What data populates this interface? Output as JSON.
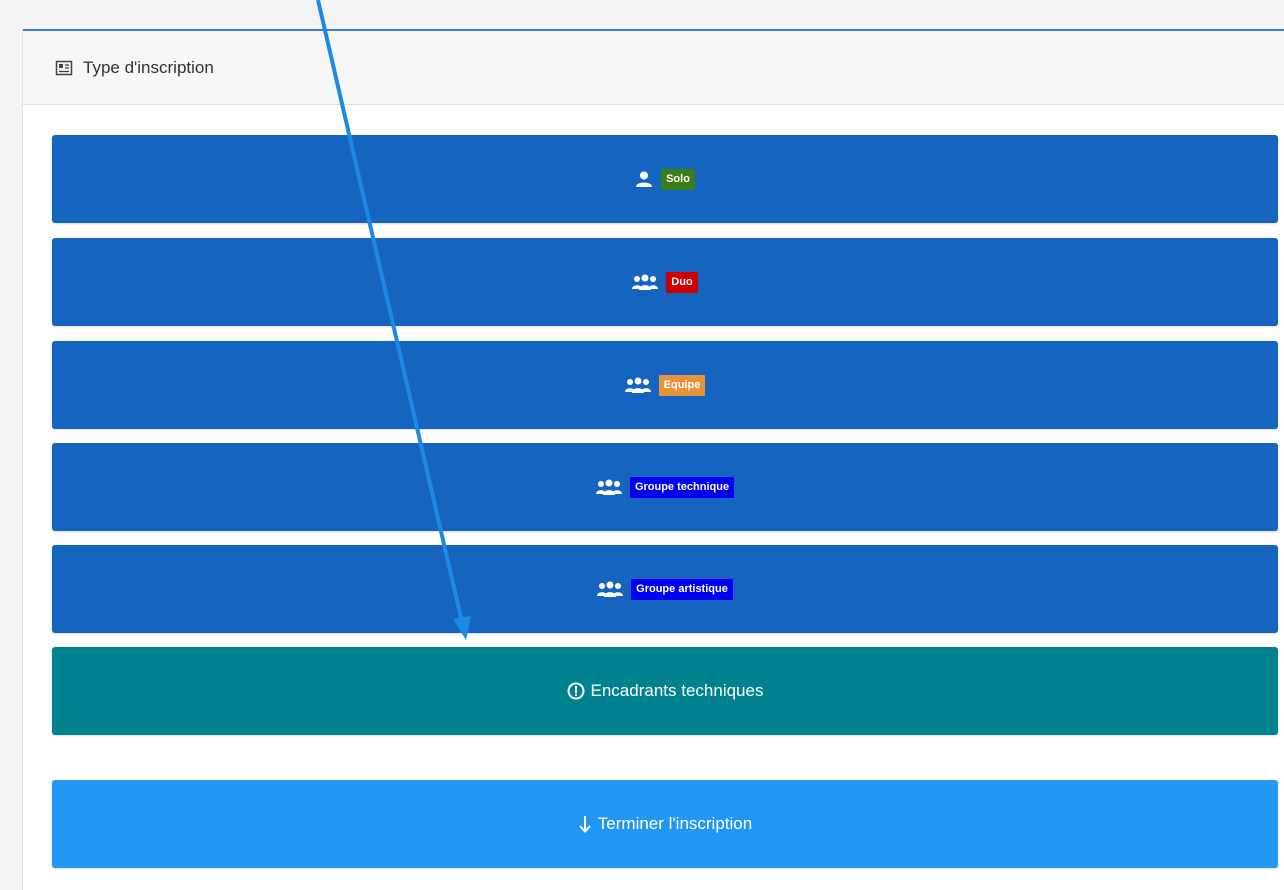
{
  "header": {
    "title": "Type d'inscription",
    "icon": "id-card-icon"
  },
  "choices": [
    {
      "label": "Solo",
      "icon": "person-icon",
      "badge_color": "#3a7d1a"
    },
    {
      "label": "Duo",
      "icon": "group-icon",
      "badge_color": "#cc0000"
    },
    {
      "label": "Equipe",
      "icon": "group-icon",
      "badge_color": "#e8923a"
    },
    {
      "label": "Groupe technique",
      "icon": "group-icon",
      "badge_color": "#0000ee"
    },
    {
      "label": "Groupe artistique",
      "icon": "group-icon",
      "badge_color": "#0000ee"
    }
  ],
  "encadrants": {
    "label": "Encadrants techniques",
    "icon": "info-circle-icon"
  },
  "terminer": {
    "label": "Terminer l'inscription",
    "icon": "arrow-down-icon"
  },
  "colors": {
    "primary": "#1565c0",
    "teal": "#00838f",
    "light_blue": "#2196f3",
    "arrow": "#1e88e5"
  }
}
